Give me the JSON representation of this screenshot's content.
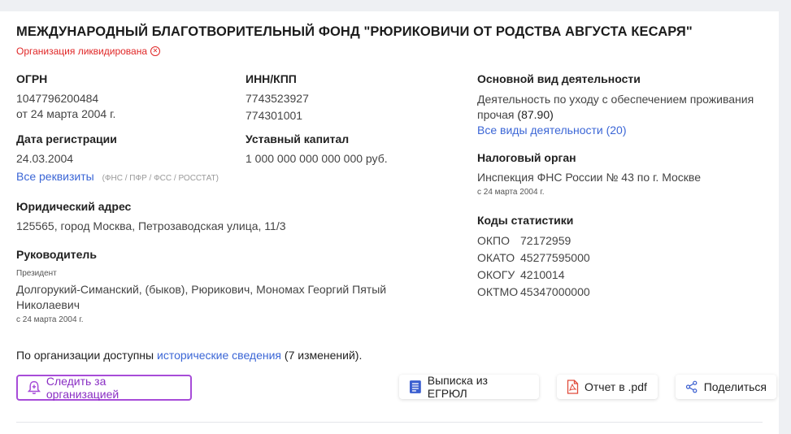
{
  "org": {
    "title": "МЕЖДУНАРОДНЫЙ БЛАГОТВОРИТЕЛЬНЫЙ ФОНД \"РЮРИКОВИЧИ ОТ РОДСТВА АВГУСТА КЕСАРЯ\"",
    "status": "Организация ликвидирована",
    "status_icon": "close-circle-icon"
  },
  "ogrn": {
    "label": "ОГРН",
    "value": "1047796200484",
    "date": "от 24 марта 2004 г."
  },
  "inn": {
    "label": "ИНН/КПП",
    "inn": "7743523927",
    "kpp": "774301001"
  },
  "reg": {
    "label": "Дата регистрации",
    "value": "24.03.2004"
  },
  "capital": {
    "label": "Уставный капитал",
    "value": "1 000 000 000 000 000 руб."
  },
  "requisites": {
    "link": "Все реквизиты",
    "note": "(ФНС / ПФР / ФСС / РОССТАТ)"
  },
  "address": {
    "label": "Юридический адрес",
    "value": "125565, город Москва, Петрозаводская улица, 11/3"
  },
  "head": {
    "label": "Руководитель",
    "role": "Президент",
    "name_line1": "Долгорукий-Симанский, (быков), Рюрикович, Мономах Георгий Пятый",
    "name_line2": "Николаевич",
    "date": "с 24 марта 2004 г."
  },
  "activity": {
    "label": "Основной вид деятельности",
    "line1": "Деятельность по уходу с обеспечением проживания",
    "line2": "прочая",
    "code": "(87.90)",
    "all_link": "Все виды деятельности (20)"
  },
  "tax": {
    "label": "Налоговый орган",
    "value": "Инспекция ФНС России № 43 по г. Москве",
    "date": "с 24 марта 2004 г."
  },
  "stats": {
    "label": "Коды статистики",
    "rows": [
      {
        "k": "ОКПО",
        "v": "72172959"
      },
      {
        "k": "ОКАТО",
        "v": "45277595000"
      },
      {
        "k": "ОКОГУ",
        "v": "4210014"
      },
      {
        "k": "ОКТМО",
        "v": "45347000000"
      }
    ]
  },
  "history": {
    "prefix": "По организации доступны ",
    "link": "исторические сведения",
    "suffix": " (7 изменений)."
  },
  "actions": {
    "follow": "Следить за организацией",
    "egrul": "Выписка из ЕГРЮЛ",
    "pdf": "Отчет в .pdf",
    "share": "Поделиться"
  },
  "colors": {
    "accent_link": "#3b66d6",
    "status_red": "#e02727",
    "follow_purple": "#a74cd8",
    "pdf_red": "#e04a3a"
  }
}
